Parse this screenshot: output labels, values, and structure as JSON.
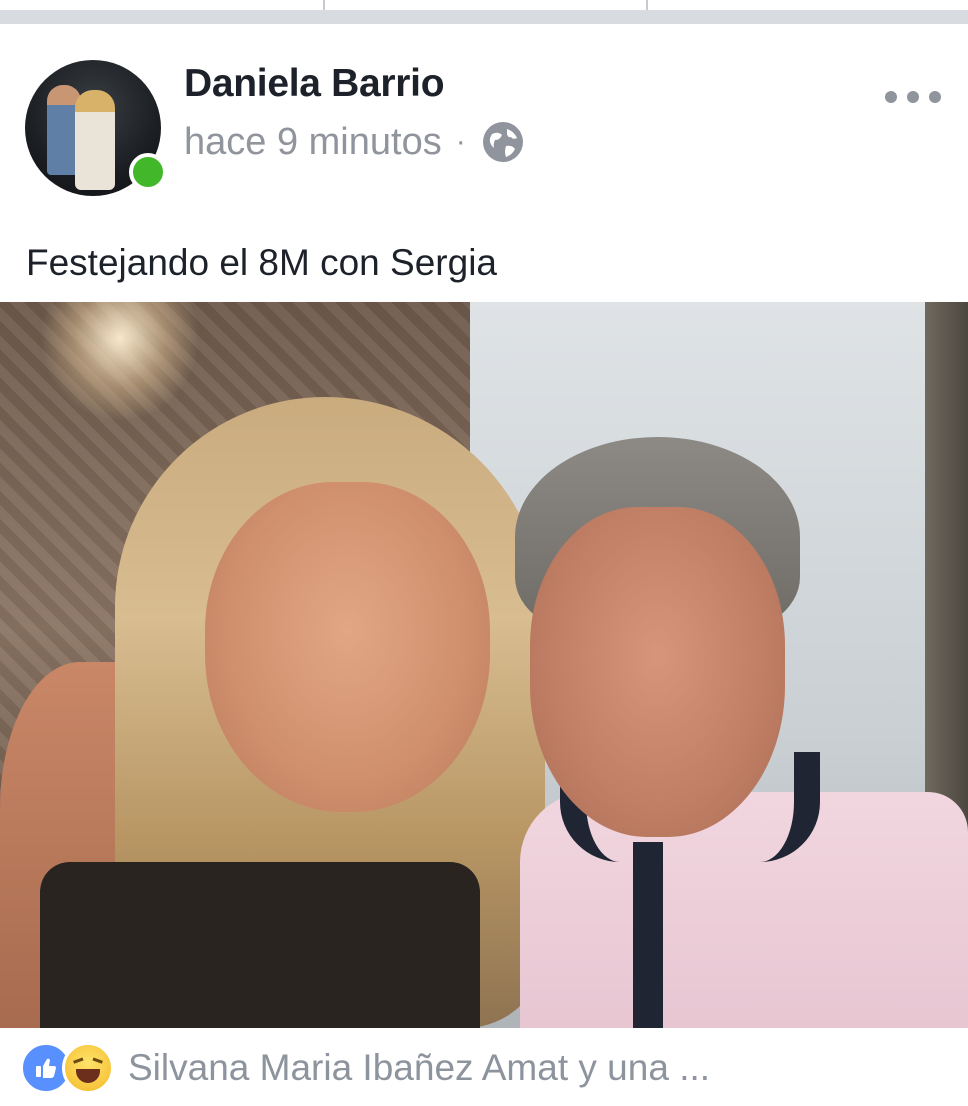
{
  "post": {
    "author": "Daniela Barrio",
    "time": "hace 9 minutos",
    "separator": "·",
    "privacy_icon": "globe-icon",
    "more_icon": "more-options-icon",
    "text": "Festejando el 8M con Sergia"
  },
  "reactions": {
    "icons": [
      "like-icon",
      "haha-icon"
    ],
    "summary": "Silvana Maria Ibañez Amat y una ..."
  },
  "colors": {
    "online": "#42b72a",
    "meta_text": "#90949c",
    "name_text": "#1d2129",
    "like_blue": "#5890ff"
  }
}
